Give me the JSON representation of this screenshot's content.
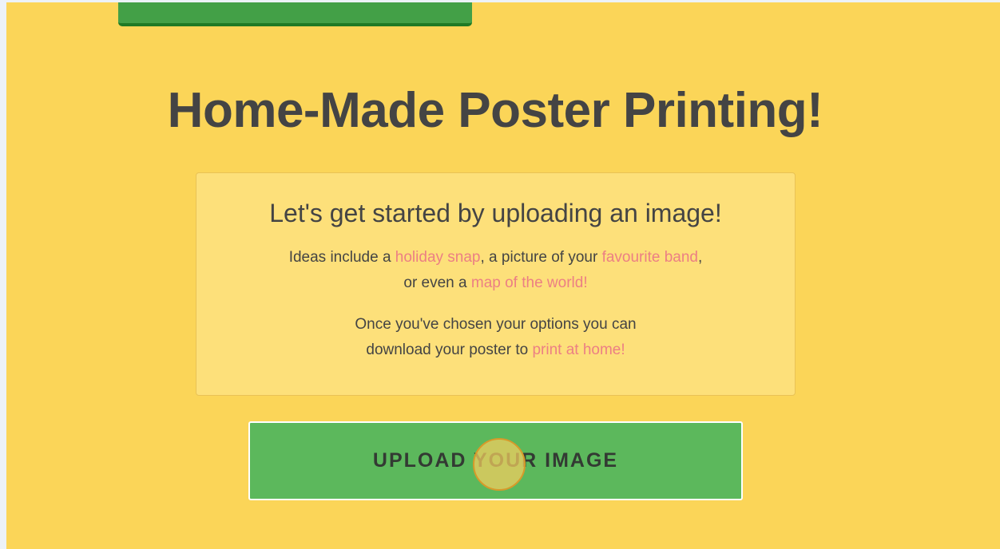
{
  "page": {
    "title": "Home-Made Poster Printing!"
  },
  "intro": {
    "heading": "Let's get started by uploading an image!",
    "paragraph1": {
      "part1": "Ideas include a ",
      "link1": "holiday snap",
      "part2": ", a picture of your ",
      "link2": "favourite band",
      "part3": ",",
      "part4": "or even a ",
      "link3": "map of the world!"
    },
    "paragraph2": {
      "part1": "Once you've chosen your options you can",
      "part2": "download your poster to ",
      "link1": "print at home!"
    }
  },
  "upload": {
    "label": "UPLOAD YOUR IMAGE"
  },
  "colors": {
    "background": "#fbd558",
    "card": "#fde07a",
    "button": "#5cb85c",
    "link": "#ec7f84",
    "text": "#444444"
  }
}
